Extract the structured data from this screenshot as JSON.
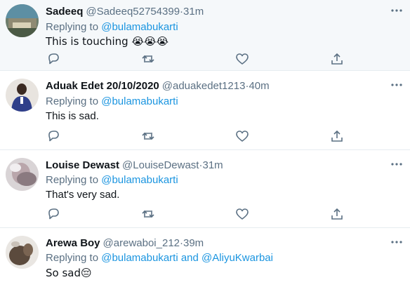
{
  "tweets": [
    {
      "name": "Sadeeq",
      "handle": "@Sadeeq52754399",
      "time": "31m",
      "replying_prefix": "Replying to ",
      "mentions": [
        "@bulamabukarti"
      ],
      "text": "This is touching 😭😭😭"
    },
    {
      "name": "Aduak Edet 20/10/2020",
      "handle": "@aduakedet1213",
      "time": "40m",
      "replying_prefix": "Replying to ",
      "mentions": [
        "@bulamabukarti"
      ],
      "text": "This is sad."
    },
    {
      "name": "Louise Dewast",
      "handle": "@LouiseDewast",
      "time": "31m",
      "replying_prefix": "Replying to ",
      "mentions": [
        "@bulamabukarti"
      ],
      "text": "That's very sad."
    },
    {
      "name": "Arewa Boy",
      "handle": "@arewaboi_212",
      "time": "39m",
      "replying_prefix": "Replying to ",
      "mentions": [
        "@bulamabukarti",
        "@AliyuKwarbai"
      ],
      "mention_joiner": " and ",
      "text": "So sad😔"
    }
  ],
  "separator": " · ",
  "icons": {
    "more": "more-options-icon",
    "reply": "reply-icon",
    "retweet": "retweet-icon",
    "like": "like-icon",
    "share": "share-icon"
  },
  "colors": {
    "link": "#1b95e0",
    "muted": "#5b7083",
    "icon": "#5b7083",
    "highlight_bg": "#f5f8fa"
  }
}
